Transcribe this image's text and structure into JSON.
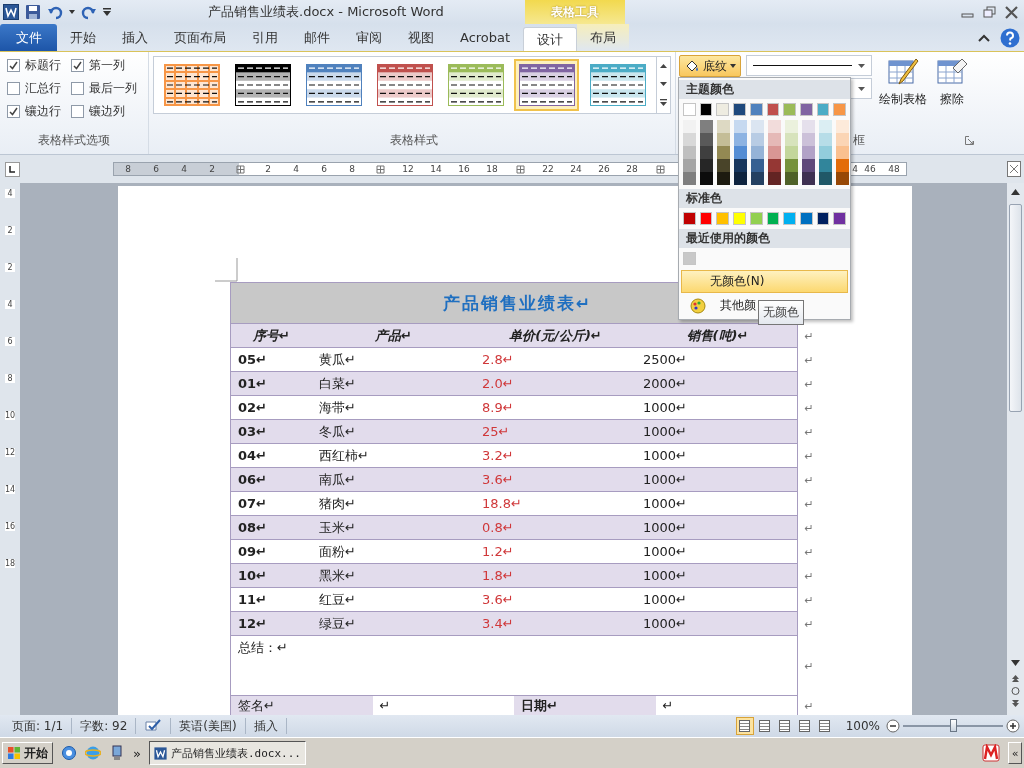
{
  "window": {
    "title": "产品销售业绩表.docx - Microsoft Word",
    "context_title": "表格工具"
  },
  "tabs": [
    {
      "label": "文件",
      "kind": "file",
      "selected": false
    },
    {
      "label": "开始",
      "kind": "tab",
      "selected": false
    },
    {
      "label": "插入",
      "kind": "tab",
      "selected": false
    },
    {
      "label": "页面布局",
      "kind": "tab",
      "selected": false
    },
    {
      "label": "引用",
      "kind": "tab",
      "selected": false
    },
    {
      "label": "邮件",
      "kind": "tab",
      "selected": false
    },
    {
      "label": "审阅",
      "kind": "tab",
      "selected": false
    },
    {
      "label": "视图",
      "kind": "tab",
      "selected": false
    },
    {
      "label": "Acrobat",
      "kind": "tab",
      "selected": false
    },
    {
      "label": "设计",
      "kind": "context",
      "selected": true
    },
    {
      "label": "布局",
      "kind": "context",
      "selected": false
    }
  ],
  "ribbon": {
    "table_style_options": [
      {
        "label": "标题行",
        "kind": "header_row",
        "checked": true
      },
      {
        "label": "第一列",
        "kind": "first_column",
        "checked": true
      },
      {
        "label": "汇总行",
        "kind": "total_row",
        "checked": false
      },
      {
        "label": "最后一列",
        "kind": "last_column",
        "checked": false
      },
      {
        "label": "镶边行",
        "kind": "banded_rows",
        "checked": true
      },
      {
        "label": "镶边列",
        "kind": "banded_columns",
        "checked": false
      }
    ],
    "options_group_label": "表格样式选项",
    "styles": [
      {
        "kind": "grid",
        "color": "#f79646",
        "selected": false
      },
      {
        "kind": "banded",
        "color": "#000000",
        "selected": false
      },
      {
        "kind": "banded",
        "color": "#4f81bd",
        "selected": false
      },
      {
        "kind": "banded",
        "color": "#c0504d",
        "selected": false
      },
      {
        "kind": "banded",
        "color": "#9bbb59",
        "selected": false
      },
      {
        "kind": "banded",
        "color": "#8064a2",
        "selected": true
      },
      {
        "kind": "banded",
        "color": "#4bacc6",
        "selected": false
      }
    ],
    "styles_group_label": "表格样式",
    "shading_button": {
      "label": "底纹",
      "pressed": true
    },
    "draw_table": "绘制表格",
    "eraser": "擦除",
    "borders_group_label": "框"
  },
  "shading_menu": {
    "theme_header": "主题颜色",
    "theme_colors": [
      {
        "color": "#ffffff",
        "shades": [
          {
            "color": "#f2f2f2"
          },
          {
            "color": "#d8d8d8"
          },
          {
            "color": "#bfbfbf"
          },
          {
            "color": "#a5a5a5"
          },
          {
            "color": "#7f7f7f"
          }
        ]
      },
      {
        "color": "#000000",
        "shades": [
          {
            "color": "#7f7f7f"
          },
          {
            "color": "#595959"
          },
          {
            "color": "#3f3f3f"
          },
          {
            "color": "#262626"
          },
          {
            "color": "#0c0c0c"
          }
        ]
      },
      {
        "color": "#eeece1",
        "shades": [
          {
            "color": "#ddd9c3"
          },
          {
            "color": "#c4bd97"
          },
          {
            "color": "#938953"
          },
          {
            "color": "#494429"
          },
          {
            "color": "#1d1b10"
          }
        ]
      },
      {
        "color": "#1f497d",
        "shades": [
          {
            "color": "#c6d9f0"
          },
          {
            "color": "#8db3e2"
          },
          {
            "color": "#548dd4"
          },
          {
            "color": "#17365d"
          },
          {
            "color": "#0f243e"
          }
        ]
      },
      {
        "color": "#4f81bd",
        "shades": [
          {
            "color": "#dbe5f1"
          },
          {
            "color": "#b8cce4"
          },
          {
            "color": "#95b3d7"
          },
          {
            "color": "#366092"
          },
          {
            "color": "#244061"
          }
        ]
      },
      {
        "color": "#c0504d",
        "shades": [
          {
            "color": "#f2dcdb"
          },
          {
            "color": "#e5b9b7"
          },
          {
            "color": "#d99694"
          },
          {
            "color": "#953734"
          },
          {
            "color": "#632423"
          }
        ]
      },
      {
        "color": "#9bbb59",
        "shades": [
          {
            "color": "#ebf1dd"
          },
          {
            "color": "#d7e3bc"
          },
          {
            "color": "#c3d69b"
          },
          {
            "color": "#76923c"
          },
          {
            "color": "#4f6128"
          }
        ]
      },
      {
        "color": "#8064a2",
        "shades": [
          {
            "color": "#e5e0ec"
          },
          {
            "color": "#ccc1d9"
          },
          {
            "color": "#b2a2c7"
          },
          {
            "color": "#5f497a"
          },
          {
            "color": "#3f3151"
          }
        ]
      },
      {
        "color": "#4bacc6",
        "shades": [
          {
            "color": "#dbeef3"
          },
          {
            "color": "#b7dde8"
          },
          {
            "color": "#92cddc"
          },
          {
            "color": "#31859b"
          },
          {
            "color": "#205867"
          }
        ]
      },
      {
        "color": "#f79646",
        "shades": [
          {
            "color": "#fdeada"
          },
          {
            "color": "#fbd5b5"
          },
          {
            "color": "#fac08f"
          },
          {
            "color": "#e36c09"
          },
          {
            "color": "#974806"
          }
        ]
      }
    ],
    "standard_header": "标准色",
    "standard_colors": [
      {
        "color": "#c00000"
      },
      {
        "color": "#ff0000"
      },
      {
        "color": "#ffc000"
      },
      {
        "color": "#ffff00"
      },
      {
        "color": "#92d050"
      },
      {
        "color": "#00b050"
      },
      {
        "color": "#00b0f0"
      },
      {
        "color": "#0070c0"
      },
      {
        "color": "#002060"
      },
      {
        "color": "#7030a0"
      }
    ],
    "recent_header": "最近使用的颜色",
    "recent_colors": [
      {
        "color": "#c8c8c8"
      }
    ],
    "no_color": "无颜色(N)",
    "more_colors": "其他颜",
    "tooltip": "无颜色"
  },
  "ruler": {
    "left": [
      {
        "kind": "number",
        "label": "8"
      },
      {
        "kind": "number",
        "label": "6"
      },
      {
        "kind": "number",
        "label": "4"
      },
      {
        "kind": "number",
        "label": "2"
      },
      {
        "kind": "marker"
      },
      {
        "kind": "number",
        "label": "2"
      },
      {
        "kind": "number",
        "label": "4"
      },
      {
        "kind": "number",
        "label": "6"
      },
      {
        "kind": "number",
        "label": "8"
      },
      {
        "kind": "marker"
      },
      {
        "kind": "number",
        "label": "12"
      },
      {
        "kind": "number",
        "label": "14"
      },
      {
        "kind": "number",
        "label": "16"
      },
      {
        "kind": "number",
        "label": "18"
      },
      {
        "kind": "marker"
      },
      {
        "kind": "number",
        "label": "22"
      },
      {
        "kind": "number",
        "label": "24"
      },
      {
        "kind": "number",
        "label": "26"
      },
      {
        "kind": "number",
        "label": "28"
      },
      {
        "kind": "marker"
      }
    ],
    "right": [
      {
        "kind": "number",
        "label": "4"
      },
      {
        "kind": "number",
        "label": "46"
      },
      {
        "kind": "number",
        "label": "48"
      }
    ],
    "vertical": [
      "4",
      "2",
      "2",
      "4",
      "6",
      "8",
      "10",
      "12",
      "14",
      "16",
      "18"
    ]
  },
  "table": {
    "title": "产品销售业绩表↵",
    "columns": [
      "序号↵",
      "产品↵",
      "单价(元/公斤)↵",
      "销售(吨)↵"
    ],
    "end_mark": "↵",
    "rows": [
      {
        "no": "05↵",
        "product": "黄瓜↵",
        "price": "2.8↵",
        "sales": "2500↵"
      },
      {
        "no": "01↵",
        "product": "白菜↵",
        "price": "2.0↵",
        "sales": "2000↵"
      },
      {
        "no": "02↵",
        "product": "海带↵",
        "price": "8.9↵",
        "sales": "1000↵"
      },
      {
        "no": "03↵",
        "product": "冬瓜↵",
        "price": "25↵",
        "sales": "1000↵"
      },
      {
        "no": "04↵",
        "product": "西红柿↵",
        "price": "3.2↵",
        "sales": "1000↵"
      },
      {
        "no": "06↵",
        "product": "南瓜↵",
        "price": "3.6↵",
        "sales": "1000↵"
      },
      {
        "no": "07↵",
        "product": "猪肉↵",
        "price": "18.8↵",
        "sales": "1000↵"
      },
      {
        "no": "08↵",
        "product": "玉米↵",
        "price": "0.8↵",
        "sales": "1000↵"
      },
      {
        "no": "09↵",
        "product": "面粉↵",
        "price": "1.2↵",
        "sales": "1000↵"
      },
      {
        "no": "10↵",
        "product": "黑米↵",
        "price": "1.8↵",
        "sales": "1000↵"
      },
      {
        "no": "11↵",
        "product": "红豆↵",
        "price": "3.6↵",
        "sales": "1000↵"
      },
      {
        "no": "12↵",
        "product": "绿豆↵",
        "price": "3.4↵",
        "sales": "1000↵"
      }
    ],
    "summary": "总结：↵",
    "sign_row": [
      {
        "text": "签名↵",
        "kind": "label",
        "bold": false
      },
      {
        "text": "↵",
        "kind": "blank",
        "bold": false
      },
      {
        "text": "日期↵",
        "kind": "label",
        "bold": true
      },
      {
        "text": "↵",
        "kind": "blank",
        "bold": false
      }
    ]
  },
  "status_bar": {
    "items": [
      "页面: 1/1",
      "字数: 92"
    ],
    "language": "英语(美国)",
    "mode": "插入",
    "views": [
      {
        "selected": true
      },
      {
        "selected": false
      },
      {
        "selected": false
      },
      {
        "selected": false
      },
      {
        "selected": false
      }
    ],
    "zoom": "100%",
    "zoom_slider": {
      "level": 0.5
    }
  },
  "taskbar": {
    "start": "开始",
    "more": "»",
    "task": "产品销售业绩表.docx...",
    "tray_toggle": "«"
  }
}
